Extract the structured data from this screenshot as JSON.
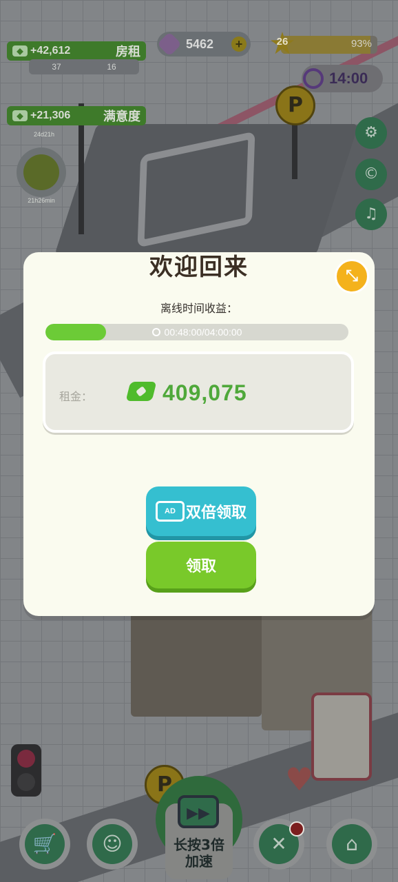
{
  "hud": {
    "rent_income": "+42,612",
    "rent_label": "房租",
    "satisfaction_income": "+21,306",
    "satisfaction_label": "满意度",
    "stat_a": "37",
    "stat_b": "16",
    "timer_a": "24d21h",
    "timer_b": "21h26min",
    "gems": "5462",
    "level": "26",
    "level_progress_label": "93%",
    "level_progress": 0.93,
    "clock": "14:00"
  },
  "dialog": {
    "title": "欢迎回来",
    "subtitle": "离线时间收益：",
    "time_elapsed": "00:48:00/04:00:00",
    "time_progress": 0.2,
    "reward_label": "租金：",
    "reward_value": "409,075",
    "ad_badge": "AD",
    "double_button": "双倍领取",
    "claim_button": "领取"
  },
  "bottom": {
    "speed_line1": "长按3倍",
    "speed_line2": "加速"
  },
  "icons": {
    "money": "money-icon",
    "gem": "gem-icon",
    "star": "star-icon",
    "clock": "clock-icon",
    "collapse": "collapse-icon",
    "settings": "gear-icon",
    "coupon": "coupon-icon",
    "notification": "bell-icon",
    "shop": "cart-icon",
    "emoji": "smile-icon",
    "tools": "tools-icon",
    "home": "home-icon",
    "tv": "tv-icon"
  },
  "colors": {
    "dialog_bg": "#fafbef",
    "progress_green": "#6ccb37",
    "double_button": "#35bfd0",
    "claim_button": "#79c92a",
    "collapse_button": "#f4b21c",
    "reward_text": "#4fa83a"
  }
}
